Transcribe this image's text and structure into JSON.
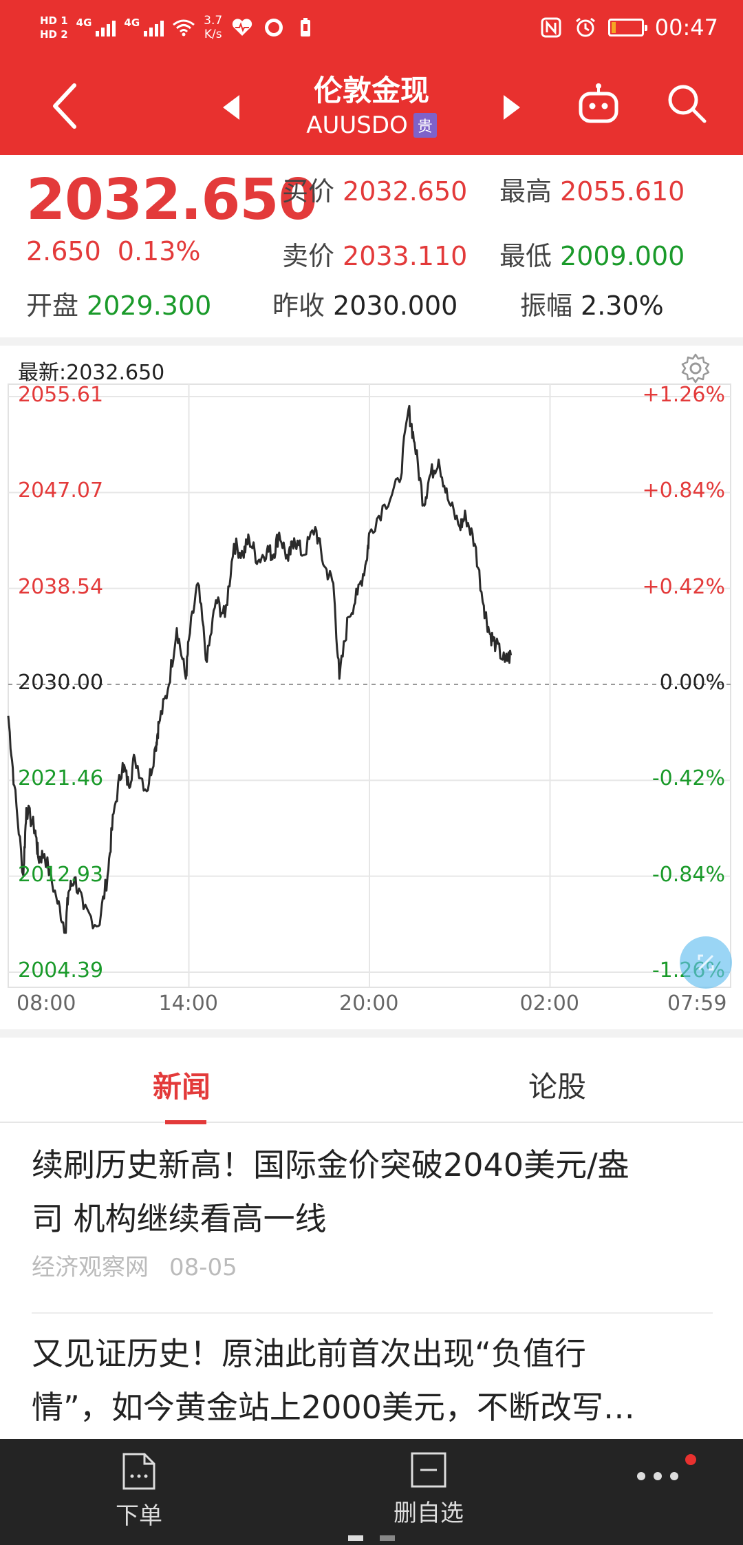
{
  "status_bar": {
    "hd1": "HD 1",
    "hd2": "HD 2",
    "net1": "4G",
    "net2": "4G",
    "speed_value": "3.7",
    "speed_unit": "K/s",
    "time": "00:47",
    "battery_level_percent": 15
  },
  "header": {
    "title": "伦敦金现",
    "symbol": "AUUSDO",
    "badge": "贵",
    "icons": [
      "back-icon",
      "prev-arrow-icon",
      "next-arrow-icon",
      "robot-icon",
      "search-icon"
    ]
  },
  "quote": {
    "price": "2032.650",
    "change": "2.650",
    "change_pct": "0.13%",
    "bid_label": "买价",
    "bid_value": "2032.650",
    "high_label": "最高",
    "high_value": "2055.610",
    "ask_label": "卖价",
    "ask_value": "2033.110",
    "low_label": "最低",
    "low_value": "2009.000",
    "open_label": "开盘",
    "open_value": "2029.300",
    "prev_close_label": "昨收",
    "prev_close_value": "2030.000",
    "amplitude_label": "振幅",
    "amplitude_value": "2.30%",
    "colors": {
      "up": "#e33a3a",
      "down": "#1a9a2a"
    }
  },
  "chart": {
    "latest_label": "最新:2032.650",
    "y_labels_left": [
      "2055.61",
      "2047.07",
      "2038.54",
      "2030.00",
      "2021.46",
      "2012.93",
      "2004.39"
    ],
    "y_labels_right": [
      "+1.26%",
      "+0.84%",
      "+0.42%",
      "0.00%",
      "-0.42%",
      "-0.84%",
      "-1.26%"
    ],
    "x_labels": [
      "08:00",
      "14:00",
      "20:00",
      "02:00",
      "07:59"
    ]
  },
  "chart_data": {
    "type": "line",
    "ylim": [
      2004.39,
      2055.61
    ],
    "baseline": 2030.0,
    "x_ticks": [
      "08:00",
      "14:00",
      "20:00",
      "02:00",
      "07:59"
    ],
    "x_range_hours": [
      0,
      24
    ],
    "series": [
      {
        "x": [
          0,
          0.2,
          0.5,
          0.6,
          0.9,
          1.0,
          1.2,
          1.6,
          1.9,
          2.0,
          2.2,
          2.5,
          3.0,
          3.3,
          3.5,
          3.8,
          4.0,
          4.2,
          4.6,
          4.9,
          5.0,
          5.3,
          5.6,
          5.9,
          6.0,
          6.3,
          6.6,
          6.9,
          7.2,
          7.5,
          7.8,
          8.0,
          8.3,
          8.6,
          8.8,
          9.0,
          9.3,
          9.5,
          9.8,
          10.2,
          10.5,
          10.8,
          11.0,
          11.3,
          11.6,
          11.9,
          12.0,
          12.5,
          13.0,
          13.3,
          13.5,
          13.8,
          14.0,
          14.3,
          14.6,
          15.0,
          15.2,
          15.5,
          15.8,
          16.0,
          16.2,
          16.5,
          16.7
        ],
        "y": [
          2027.2,
          2021.0,
          2013.0,
          2019.0,
          2017.0,
          2014.5,
          2014.9,
          2011.0,
          2008.2,
          2011.5,
          2012.8,
          2010.0,
          2008.5,
          2013.0,
          2018.5,
          2023.0,
          2021.0,
          2023.5,
          2020.5,
          2024.5,
          2026.5,
          2029.5,
          2035.0,
          2030.5,
          2034.0,
          2039.0,
          2032.0,
          2037.5,
          2036.0,
          2042.5,
          2041.5,
          2043.0,
          2041.0,
          2042.0,
          2041.5,
          2043.5,
          2041.0,
          2043.0,
          2041.5,
          2044.0,
          2040.5,
          2039.0,
          2030.5,
          2036.0,
          2038.0,
          2041.0,
          2043.5,
          2046.0,
          2048.0,
          2054.5,
          2051.5,
          2046.0,
          2048.5,
          2050.0,
          2046.5,
          2044.0,
          2045.0,
          2042.5,
          2037.0,
          2034.5,
          2033.5,
          2032.0,
          2032.6
        ]
      }
    ]
  },
  "tabs": {
    "news": "新闻",
    "forum": "论股",
    "active": "news"
  },
  "news": [
    {
      "line1": "续刷历史新高！国际金价突破2040美元/盎",
      "line2": "司 机构继续看高一线",
      "source": "经济观察网",
      "date": "08-05"
    },
    {
      "line1": "又见证历史！原油此前首次出现“负值行",
      "line2": "情”，如今黄金站上2000美元，不断改写…"
    }
  ],
  "bottom_bar": {
    "order": "下单",
    "remove": "删自选"
  }
}
